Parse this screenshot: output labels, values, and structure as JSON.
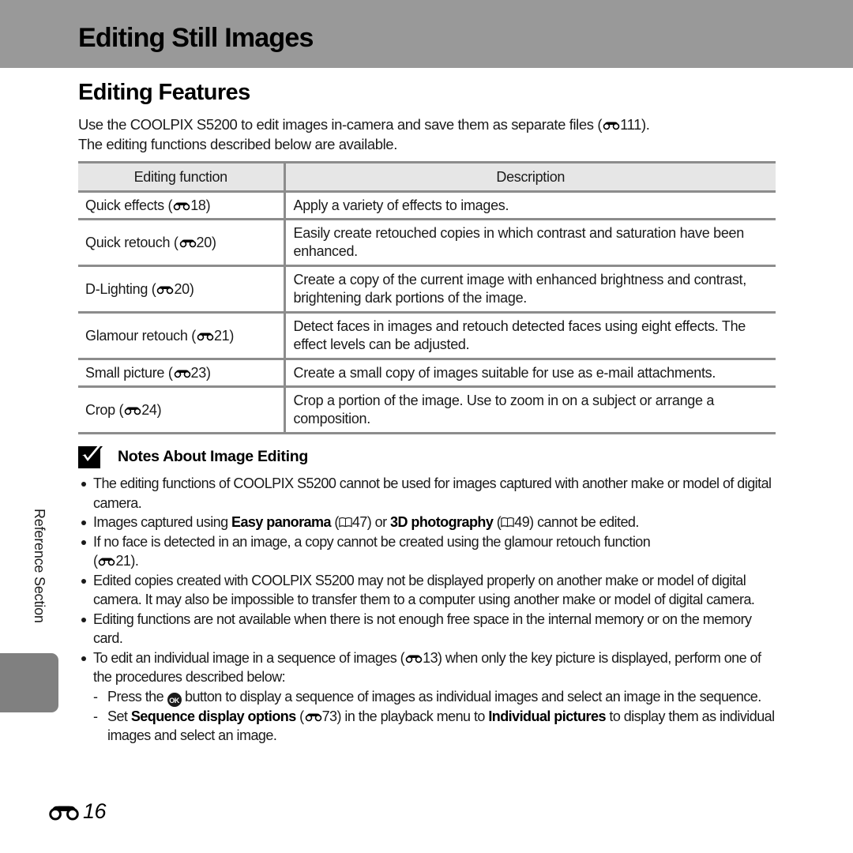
{
  "header": {
    "title": "Editing Still Images",
    "background_color": "#999999"
  },
  "section": {
    "title": "Editing Features",
    "intro_line1_before": "Use the COOLPIX S5200 to edit images in-camera and save them as separate files (",
    "intro_ref": "111",
    "intro_line1_after": ").",
    "intro_line2": "The editing functions described below are available."
  },
  "table": {
    "headers": [
      "Editing function",
      "Description"
    ],
    "rows": [
      {
        "function": "Quick effects (",
        "ref": "18",
        "description": "Apply a variety of effects to images."
      },
      {
        "function": "Quick retouch (",
        "ref": "20",
        "description": "Easily create retouched copies in which contrast and saturation have been enhanced."
      },
      {
        "function": "D-Lighting (",
        "ref": "20",
        "description": "Create a copy of the current image with enhanced brightness and contrast, brightening dark portions of the image."
      },
      {
        "function": "Glamour retouch (",
        "ref": "21",
        "description": "Detect faces in images and retouch detected faces using eight effects. The effect levels can be adjusted."
      },
      {
        "function": "Small picture (",
        "ref": "23",
        "description": "Create a small copy of images suitable for use as e-mail attachments."
      },
      {
        "function": "Crop (",
        "ref": "24",
        "description": "Crop a portion of the image. Use to zoom in on a subject or arrange a composition."
      }
    ],
    "close_paren": ")"
  },
  "notes": {
    "icon": "checkmark-icon",
    "title": "Notes About Image Editing",
    "items": [
      {
        "text": "The editing functions of COOLPIX S5200 cannot be used for images captured with another make or model of digital camera."
      },
      {
        "pre": "Images captured using ",
        "bold1": "Easy panorama",
        "mid1": " (",
        "ref1": "47",
        "mid2": ") or ",
        "bold2": "3D photography",
        "mid3": " (",
        "ref2": "49",
        "post": ") cannot be edited."
      },
      {
        "text": "If no face is detected in an image, a copy cannot be created using the glamour retouch function",
        "open": "(",
        "ref": "21",
        "close": ")."
      },
      {
        "text": "Edited copies created with COOLPIX S5200 may not be displayed properly on another make or model of digital camera. It may also be impossible to transfer them to a computer using another make or model of digital camera."
      },
      {
        "text": "Editing functions are not available when there is not enough free space in the internal memory or on the memory card."
      },
      {
        "pre": "To edit an individual image in a sequence of images (",
        "ref": "13",
        "post": ") when only the key picture is displayed, perform one of the procedures described below:",
        "subitems": [
          {
            "dash": "-",
            "pre": "Press the ",
            "button": "OK",
            "post": " button to display a sequence of images as individual images and select an image in the sequence."
          },
          {
            "dash": "-",
            "pre": "Set ",
            "bold1": "Sequence display options",
            "mid1": " (",
            "ref": "73",
            "mid2": ") in the playback menu to ",
            "bold2": "Individual pictures",
            "post": " to display them as individual images and select an image."
          }
        ]
      }
    ]
  },
  "sidebar": {
    "label": "Reference Section",
    "tab_color": "#808080"
  },
  "footer": {
    "page_number": "16",
    "icon": "reference-binoculars-icon"
  }
}
